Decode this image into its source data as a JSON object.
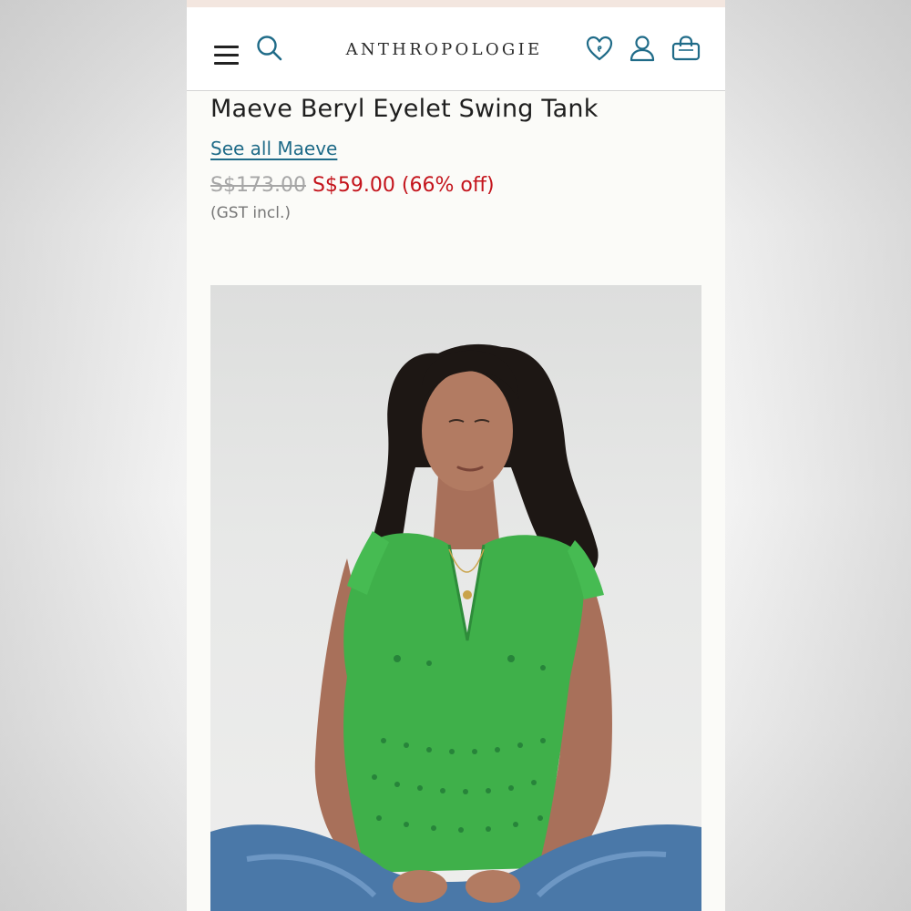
{
  "header": {
    "logo_text": "ANTHROPOLOGIE",
    "icons": [
      "menu-icon",
      "search-icon",
      "heart-icon",
      "account-icon",
      "bag-icon"
    ]
  },
  "product": {
    "title": "Maeve Beryl Eyelet Swing Tank",
    "brand_link": "See all Maeve",
    "price_original": "S$173.00",
    "price_sale": "S$59.00",
    "discount": "(66% off)",
    "tax_note": "(GST incl.)"
  },
  "colors": {
    "accent_teal": "#1f6b88",
    "sale_red": "#c4141c",
    "top_green": "#3fb04a",
    "denim_blue": "#4a78a8"
  }
}
